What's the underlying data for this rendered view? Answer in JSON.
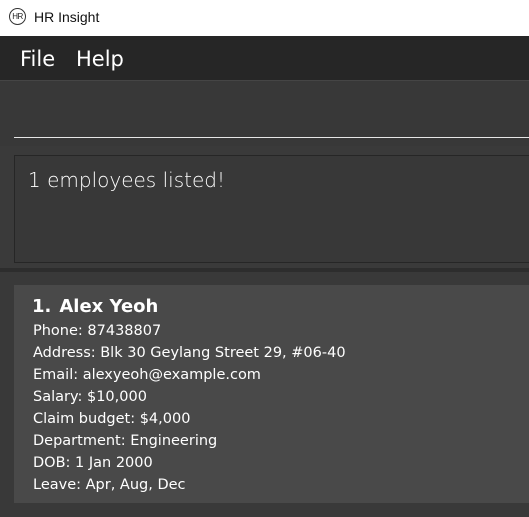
{
  "window": {
    "title": "HR Insight",
    "icon_text": "HR",
    "icon": "hr-logo-icon"
  },
  "menu": {
    "file": "File",
    "help": "Help"
  },
  "command": {
    "value": "",
    "placeholder": ""
  },
  "result": {
    "message": "1 employees listed!"
  },
  "employees": [
    {
      "index": "1.",
      "name": "Alex Yeoh",
      "phone": "Phone: 87438807",
      "address": "Address: Blk 30 Geylang Street 29, #06-40",
      "email": "Email: alexyeoh@example.com",
      "salary": "Salary: $10,000",
      "claim_budget": "Claim budget: $4,000",
      "department": "Department: Engineering",
      "dob": "DOB: 1 Jan 2000",
      "leave": "Leave: Apr, Aug, Dec"
    }
  ],
  "colors": {
    "background": "#3a3a3a",
    "menubar": "#262626",
    "card": "#494949",
    "text": "#ffffff"
  }
}
